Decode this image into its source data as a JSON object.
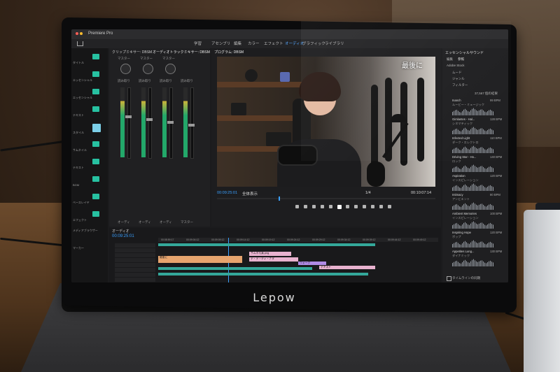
{
  "app_title": "Premiere Pro",
  "workspace_tabs": [
    "学習",
    "アセンブリ",
    "編集",
    "カラー",
    "エフェクト",
    "オーディオ",
    "グラフィック",
    "ライブラリ"
  ],
  "active_tab_index": 5,
  "panels": {
    "mixer_tab": "オーディオトラックミキサー: DBSM",
    "clip_mixer_tab": "クリップミキサー: DBSM",
    "program_tab": "プログラム: DBSM",
    "essential_sound_tab": "エッセンシャルサウンド",
    "timeline_tab": "オーディオ",
    "mixer_knob_labels": [
      "マスター",
      "マスター",
      "マスター"
    ],
    "mixer_channel_labels": [
      "読み取り",
      "読み取り",
      "読み取り",
      "読み取り"
    ],
    "mixer_footer_labels": [
      "オーディ",
      "オーディ",
      "オーディ",
      "マスター"
    ]
  },
  "program": {
    "caption": "最後に",
    "timecode_current": "00:09:25:01",
    "timecode_total": "00:10:07:14",
    "fit_label": "全体表示",
    "fraction": "1/4"
  },
  "timeline": {
    "timecode": "00:09:25:01",
    "ruler_labels": [
      "00:08:59:17",
      "00:09:04:12",
      "00:09:09:12",
      "00:09:14:12",
      "00:09:19:12",
      "00:09:24:12",
      "00:09:29:12",
      "00:09:34:12",
      "00:09:39:12",
      "00:09:44:12",
      "00:09:49:12"
    ],
    "clip_labels": [
      "最後に",
      "サムネ写真.png",
      "デ・デ・ディ・ナタ",
      "ウォーク",
      "テキスト"
    ]
  },
  "essential_sound": {
    "tabs": [
      "編集",
      "参照"
    ],
    "search_label": "Adobe Stock",
    "categories": [
      "ムード",
      "ジャンル",
      "フィルター"
    ],
    "count_label": "37,567 個の結果",
    "items": [
      {
        "title": "Inanch",
        "sub": "ムービー・ミュージック",
        "bpm": "99 BPM"
      },
      {
        "title": "Gimlantes - Hal...",
        "sub": "シネマティック",
        "bpm": "128 BPM"
      },
      {
        "title": "Infected Light",
        "sub": "ダーク・エレクトロ",
        "bpm": "110 BPM"
      },
      {
        "title": "Driving Star - Ho...",
        "sub": "ロック",
        "bpm": "140 BPM"
      },
      {
        "title": "Aspiration",
        "sub": "インスピレーション",
        "bpm": "120 BPM"
      },
      {
        "title": "Intimacy",
        "sub": "アンビエント",
        "bpm": "80 BPM"
      },
      {
        "title": "Ambient Memories",
        "sub": "インスピレーション",
        "bpm": "100 BPM"
      },
      {
        "title": "Inspiring Hope",
        "sub": "ポップ",
        "bpm": "120 BPM"
      },
      {
        "title": "Appetites Lung...",
        "sub": "ダイナミック",
        "bpm": "130 BPM"
      }
    ],
    "footer_label": "タイムラインの同期"
  },
  "left_labels": [
    "タイトル",
    "エッセンシャル",
    "エッセンシャル",
    "テキスト",
    "スタイル",
    "サムネイル",
    "テキスト",
    "BGM",
    "ベースレイヤ",
    "エフェクト",
    "メディアブラウザー",
    "マーカー"
  ],
  "monitor_brand": "Lepow",
  "colors": {
    "accent": "#3aa0ff",
    "track_teal": "#27c1a1"
  }
}
